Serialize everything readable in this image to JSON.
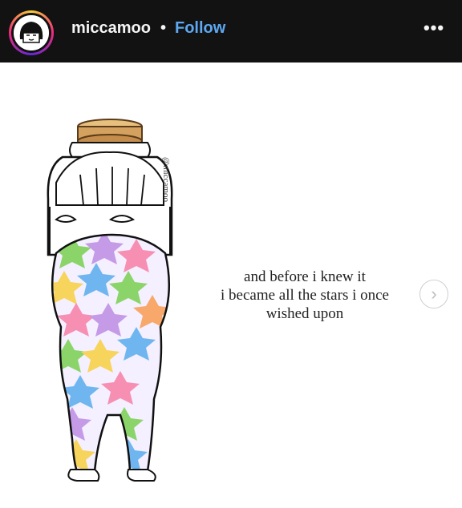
{
  "header": {
    "username": "miccamoo",
    "separator": "•",
    "follow_label": "Follow",
    "more_label": "•••"
  },
  "post": {
    "watermark": "@miccamoo",
    "caption_lines": [
      "and before i knew it",
      "i became all the stars i once",
      "wished upon"
    ],
    "next_label": "›"
  },
  "colors": {
    "header_bg": "#121212",
    "follow": "#5da8f0",
    "cork": "#d4a15f"
  }
}
